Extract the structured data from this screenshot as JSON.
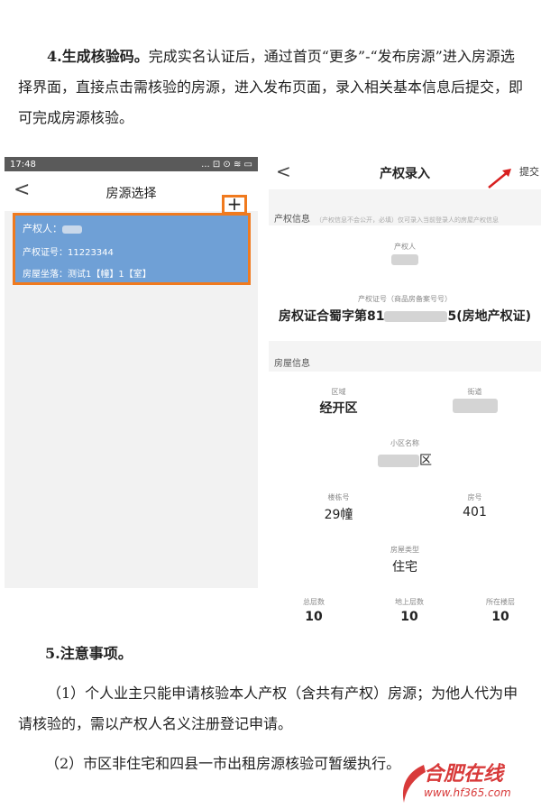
{
  "para1": {
    "heading": "4.生成核验码。",
    "body": "完成实名认证后，通过首页“更多”-“发布房源”进入房源选择界面，直接点击需核验的房源，进入发布页面，录入相关基本信息后提交，即可完成房源核验。"
  },
  "left_phone": {
    "time": "17:48",
    "status_icons": "... ⊡ ⊙ ≋ ▭",
    "back": "<",
    "title": "房源选择",
    "plus": "+",
    "card": {
      "owner_label": "产权人：",
      "cert": "产权证号：11223344",
      "address": "房屋坐落：测试1【幢】1【室】"
    }
  },
  "right_phone": {
    "back": "<",
    "title": "产权录入",
    "submit": "提交",
    "property_section": "产权信息",
    "property_note": "（产权信息不会公开，必填）仅可录入当前登录人的房屋产权信息",
    "owner_label": "产权人",
    "cert_label": "产权证号（商品房备案号号）",
    "cert_value_prefix": "房权证合蜀字第81",
    "cert_value_suffix": "5(房地产权证)",
    "house_section": "房屋信息",
    "district_label": "区域",
    "district_value": "经开区",
    "street_label": "街道",
    "community_label": "小区名称",
    "community_suffix": "区",
    "building_label": "楼栋号",
    "building_value": "29幢",
    "room_label": "房号",
    "room_value": "401",
    "type_label": "房屋类型",
    "type_value": "住宅",
    "total_floor_label": "总层数",
    "total_floor_value": "10",
    "above_floor_label": "地上层数",
    "above_floor_value": "10",
    "at_floor_label": "所在楼层",
    "at_floor_value": "10"
  },
  "notes": {
    "heading": "5.注意事项。",
    "item1": "（1）个人业主只能申请核验本人产权（含共有产权）房源；为他人代为申请核验的，需以产权人名义注册登记申请。",
    "item2": "（2）市区非住宅和四县一市出租房源核验可暂缓执行。"
  },
  "watermark": {
    "logo_text": "合肥在线",
    "url": "www.hf365.com"
  },
  "colors": {
    "highlight": "#f07a1e",
    "card_blue": "#6fa0d6",
    "brand_red": "#d83a3a"
  }
}
